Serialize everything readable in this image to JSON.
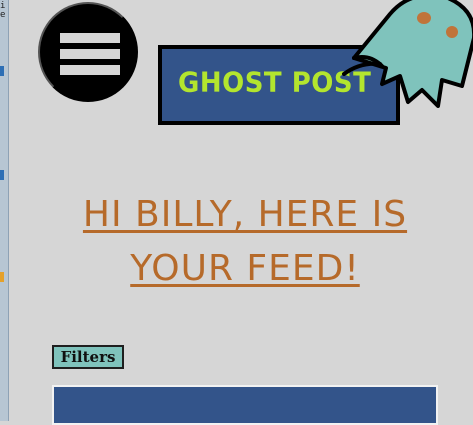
{
  "header": {
    "menu_icon": "hamburger-icon",
    "logo_text": "GHOST POST",
    "logo_icon": "ghost-icon"
  },
  "main": {
    "greeting_line1": "HI BILLY, HERE IS",
    "greeting_line2": "YOUR FEED!",
    "filters_label": "Filters"
  },
  "colors": {
    "background": "#d6d6d6",
    "brand_navy": "#33548a",
    "logo_green": "#b3e52e",
    "ghost_teal": "#7fc3bc",
    "greeting_orange": "#b66a2a",
    "ghost_eye": "#c0743a"
  }
}
